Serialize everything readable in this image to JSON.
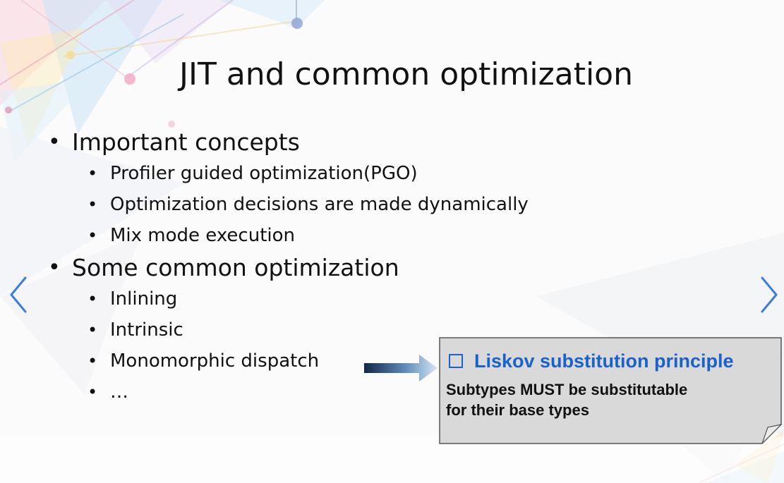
{
  "slide": {
    "title": "JIT and common optimization",
    "bullets": [
      {
        "text": "Important concepts",
        "sub": [
          "Profiler guided optimization(PGO)",
          "Optimization decisions are made dynamically",
          "Mix mode execution"
        ]
      },
      {
        "text": "Some  common optimization",
        "sub": [
          "Inlining",
          "Intrinsic",
          "Monomorphic dispatch",
          "…"
        ]
      }
    ]
  },
  "callout": {
    "title": "Liskov substitution principle",
    "body_line1": "Subtypes MUST be substitutable",
    "body_line2": "for their base types"
  },
  "nav": {
    "prev_icon": "chevron-left-icon",
    "next_icon": "chevron-right-icon"
  },
  "colors": {
    "accent": "#1a62c9",
    "nav": "#3b7ce0",
    "callout_bg": "#d9d9d9"
  }
}
